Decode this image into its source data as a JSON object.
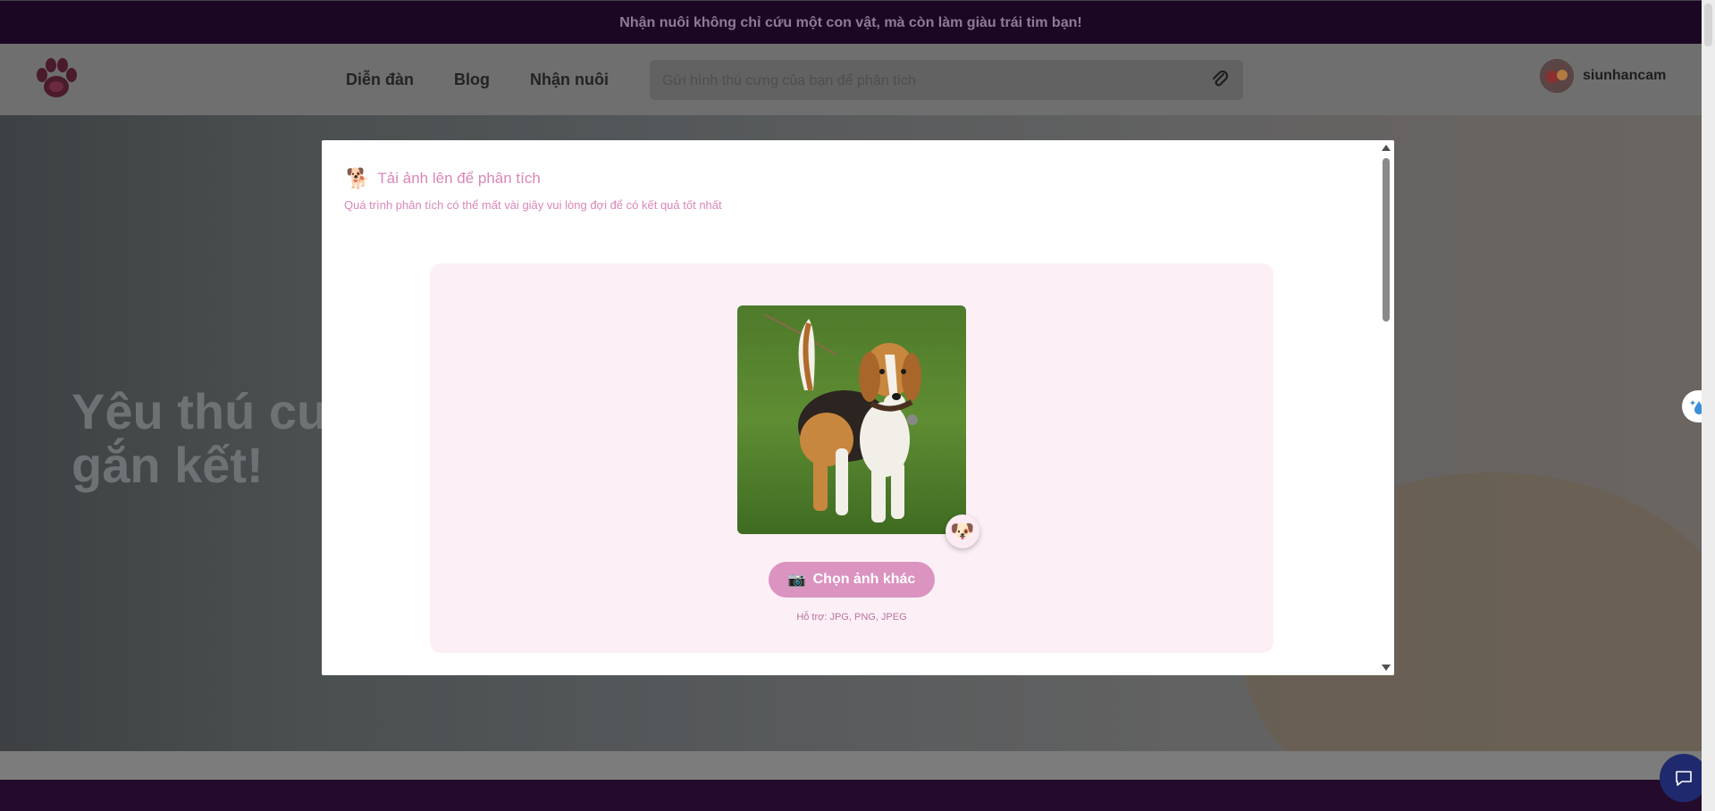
{
  "banner": {
    "text": "Nhận nuôi không chỉ cứu một con vật, mà còn làm giàu trái tim bạn!"
  },
  "nav": {
    "items": [
      {
        "label": "Diễn đàn"
      },
      {
        "label": "Blog"
      },
      {
        "label": "Nhận nuôi"
      }
    ]
  },
  "search": {
    "placeholder": "Gửi hình thú cưng của bạn để phân tích"
  },
  "user": {
    "name": "siunhancam"
  },
  "hero": {
    "title": "Yêu thú cư\ngắn kết!"
  },
  "modal": {
    "title": "Tải ảnh lên để phân tích",
    "subtitle": "Quá trình phân tích có thể mất vài giây vui lòng đợi để có kết quả tốt nhất",
    "choose_button": "Chọn ảnh khác",
    "supported": "Hỗ trợ: JPG, PNG, JPEG"
  },
  "icons": {
    "title_icon": "dog-icon",
    "badge_icon": "dog-face-icon",
    "button_icon": "camera-icon",
    "attach_icon": "paperclip-icon",
    "chat_icon": "chat-icon",
    "side_icon": "sparkle-drop-icon"
  },
  "colors": {
    "accent": "#db93c0",
    "accent_text": "#d987b8",
    "banner_bg": "#1b0724",
    "upload_bg": "#fcf0f6"
  }
}
